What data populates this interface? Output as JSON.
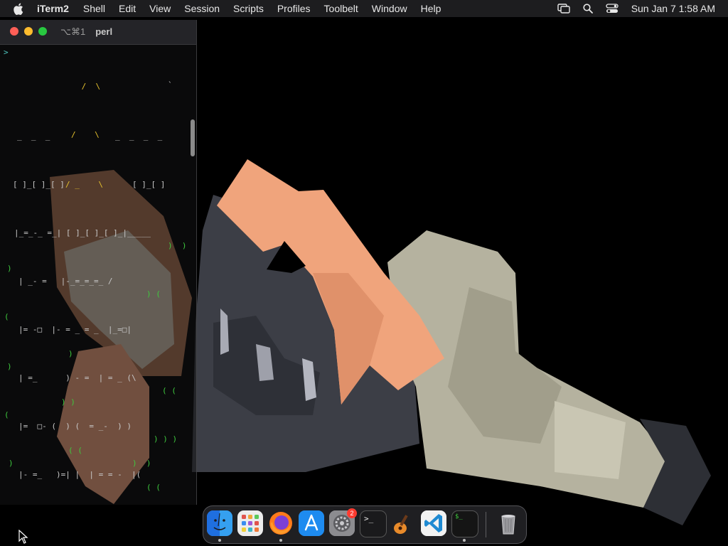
{
  "menubar": {
    "apple_icon": "apple-logo-icon",
    "app_name": "iTerm2",
    "menus": [
      "Shell",
      "Edit",
      "View",
      "Session",
      "Scripts",
      "Profiles",
      "Toolbelt",
      "Window",
      "Help"
    ],
    "status_icons": [
      "screen-mirroring-icon",
      "search-icon",
      "control-center-icon"
    ],
    "clock": "Sun Jan 7  1:58 AM"
  },
  "terminal": {
    "shortcut": "⌥⌘1",
    "title": "perl",
    "prompt": ">",
    "ascii_art_yellow": [
      " /  \\",
      "/    \\",
      "/ _    \\"
    ],
    "ascii_art_gray": [
      "_  _  _",
      "_  _  _  _",
      "[ ]_[ ]_[ ]",
      "[ ]_[ ]",
      "|_=_-_ =_| [ ]_[ ]_[ ]_|_____",
      "| _- =   |-_=_=_=_ /",
      "|= -□  |- = _ = _  |_=□|",
      "| =_      ) - =  | = _ (\\",
      "|=  □- (  ) (  = _-  ) )",
      "|- =_   )=| |  | = = -  |("
    ],
    "ascii_art_green": [
      ")",
      "(",
      ")",
      "(",
      ")",
      ")",
      ")  )",
      ") (",
      "( (",
      ") )",
      ") ) )",
      "( (",
      ")  )",
      "( ("
    ]
  },
  "scene": {
    "colors": {
      "skin": "#f0a47c",
      "shirt": "#3c3e46",
      "pants": "#b5b29f",
      "shoe": "#2d2f35",
      "background": "#000000"
    }
  },
  "dock": {
    "items": [
      {
        "name": "Finder",
        "icon": "finder-icon",
        "running": true
      },
      {
        "name": "Launchpad",
        "icon": "launchpad-icon",
        "running": false
      },
      {
        "name": "Firefox",
        "icon": "firefox-icon",
        "running": true
      },
      {
        "name": "App Store",
        "icon": "app-store-icon",
        "running": false
      },
      {
        "name": "System Settings",
        "icon": "system-settings-icon",
        "running": false,
        "badge": "2"
      },
      {
        "name": "Terminal",
        "icon": "terminal-icon",
        "running": false
      },
      {
        "name": "GarageBand",
        "icon": "garageband-icon",
        "running": false
      },
      {
        "name": "Visual Studio Code",
        "icon": "vscode-icon",
        "running": false
      },
      {
        "name": "iTerm2",
        "icon": "iterm2-icon",
        "running": true
      },
      {
        "name": "Trash",
        "icon": "trash-icon",
        "running": false
      }
    ],
    "settings_badge": "2"
  }
}
